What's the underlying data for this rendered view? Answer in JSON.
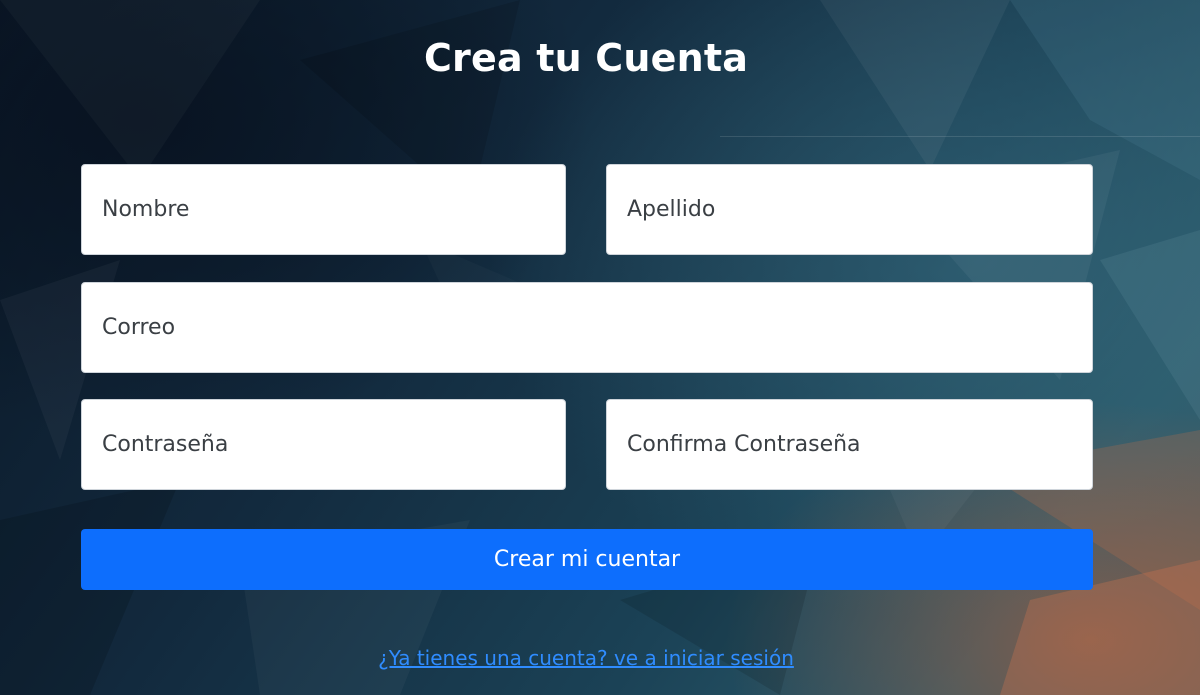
{
  "page": {
    "title": "Crea tu Cuenta"
  },
  "form": {
    "first_name": {
      "placeholder": "Nombre",
      "value": ""
    },
    "last_name": {
      "placeholder": "Apellido",
      "value": ""
    },
    "email": {
      "placeholder": "Correo",
      "value": ""
    },
    "password": {
      "placeholder": "Contraseña",
      "value": ""
    },
    "confirm_password": {
      "placeholder": "Confirma Contraseña",
      "value": ""
    },
    "submit_label": "Crear mi cuentar"
  },
  "footer": {
    "login_link": "¿Ya tienes una cuenta? ve a iniciar sesión"
  },
  "colors": {
    "primary": "#0d6efd",
    "link": "#2f8cff",
    "background_dark": "#0a1726",
    "background_accent": "#be5f37"
  }
}
